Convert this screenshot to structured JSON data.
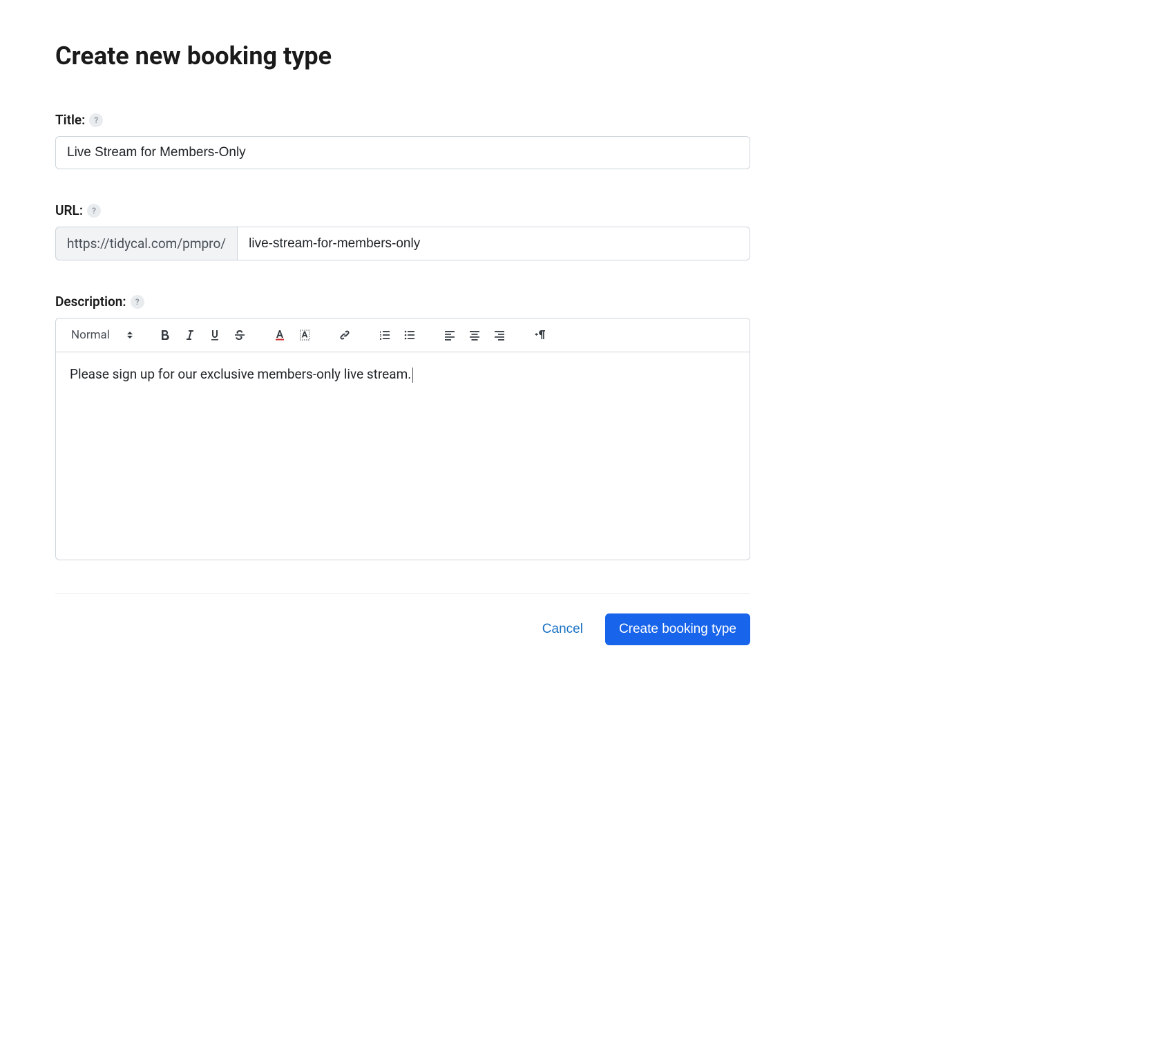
{
  "header": {
    "title": "Create new booking type"
  },
  "form": {
    "title": {
      "label": "Title:",
      "value": "Live Stream for Members-Only"
    },
    "url": {
      "label": "URL:",
      "prefix": "https://tidycal.com/pmpro/",
      "value": "live-stream-for-members-only"
    },
    "description": {
      "label": "Description:",
      "format_label": "Normal",
      "content": "Please sign up for our exclusive members-only live stream."
    }
  },
  "actions": {
    "cancel": "Cancel",
    "submit": "Create booking type"
  }
}
